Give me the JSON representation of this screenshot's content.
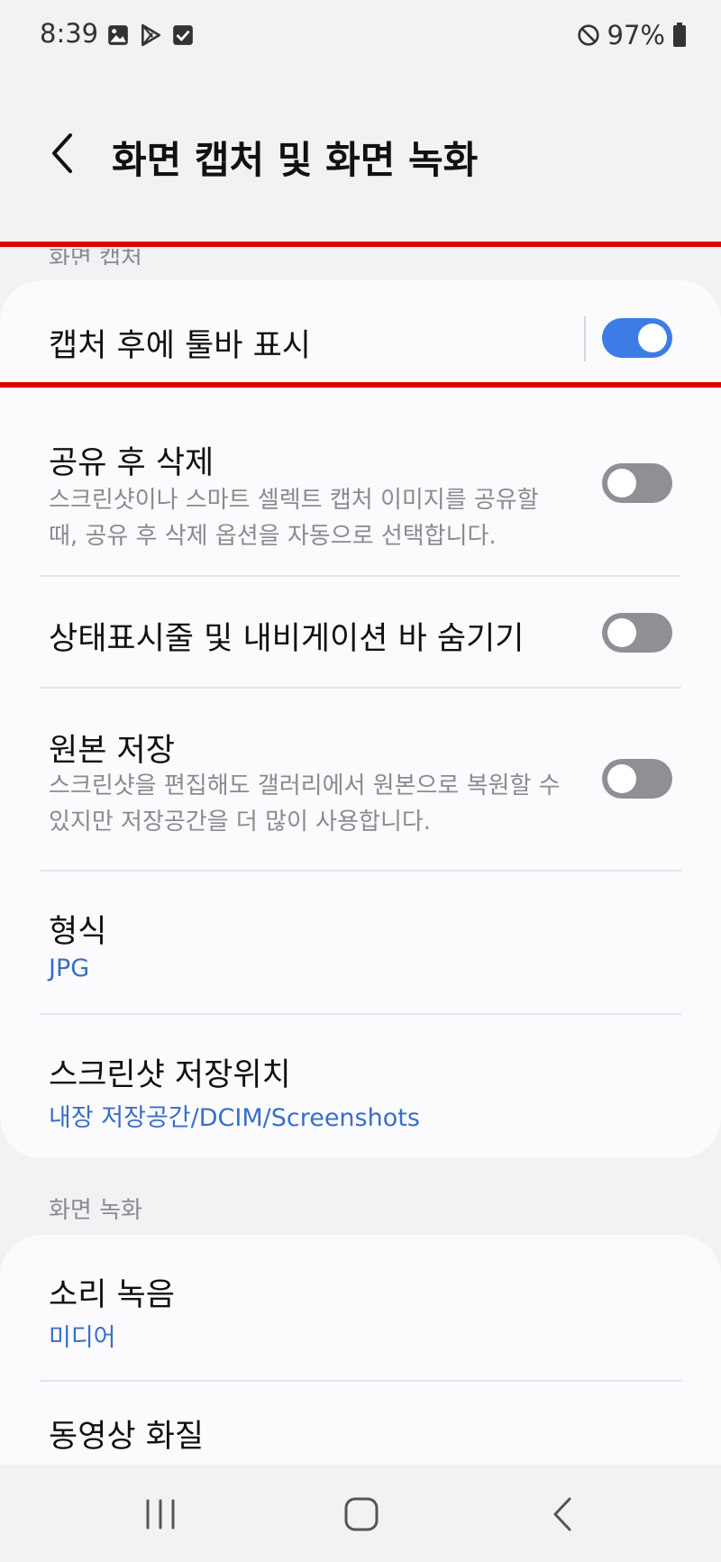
{
  "status_bar": {
    "time": "8:39",
    "battery": "97%",
    "left_icons": [
      "gallery-icon",
      "play-store-icon",
      "check-box-icon"
    ],
    "right_icons": [
      "do-not-disturb-icon",
      "battery-icon"
    ]
  },
  "header": {
    "title": "화면 캡처 및 화면 녹화"
  },
  "sections": {
    "capture_label": "화면 캡처",
    "recording_label": "화면 녹화"
  },
  "capture_settings": {
    "toolbar": {
      "title": "캡처 후에 툴바 표시",
      "enabled": true
    },
    "delete_after_share": {
      "title": "공유 후 삭제",
      "subtitle": "스크린샷이나 스마트 셀렉트 캡처 이미지를 공유할 때, 공유 후 삭제 옵션을 자동으로 선택합니다.",
      "enabled": false
    },
    "hide_bars": {
      "title": "상태표시줄 및 내비게이션 바 숨기기",
      "enabled": false
    },
    "save_original": {
      "title": "원본 저장",
      "subtitle": "스크린샷을 편집해도 갤러리에서 원본으로 복원할 수 있지만 저장공간을 더 많이 사용합니다.",
      "enabled": false
    },
    "format": {
      "title": "형식",
      "value": "JPG"
    },
    "location": {
      "title": "스크린샷 저장위치",
      "value": "내장 저장공간/DCIM/Screenshots"
    }
  },
  "recording_settings": {
    "sound": {
      "title": "소리 녹음",
      "value": "미디어"
    },
    "quality": {
      "title": "동영상 화질"
    }
  },
  "colors": {
    "accent": "#3d7ce6",
    "link": "#3a6ec6",
    "highlight": "#e00000"
  }
}
